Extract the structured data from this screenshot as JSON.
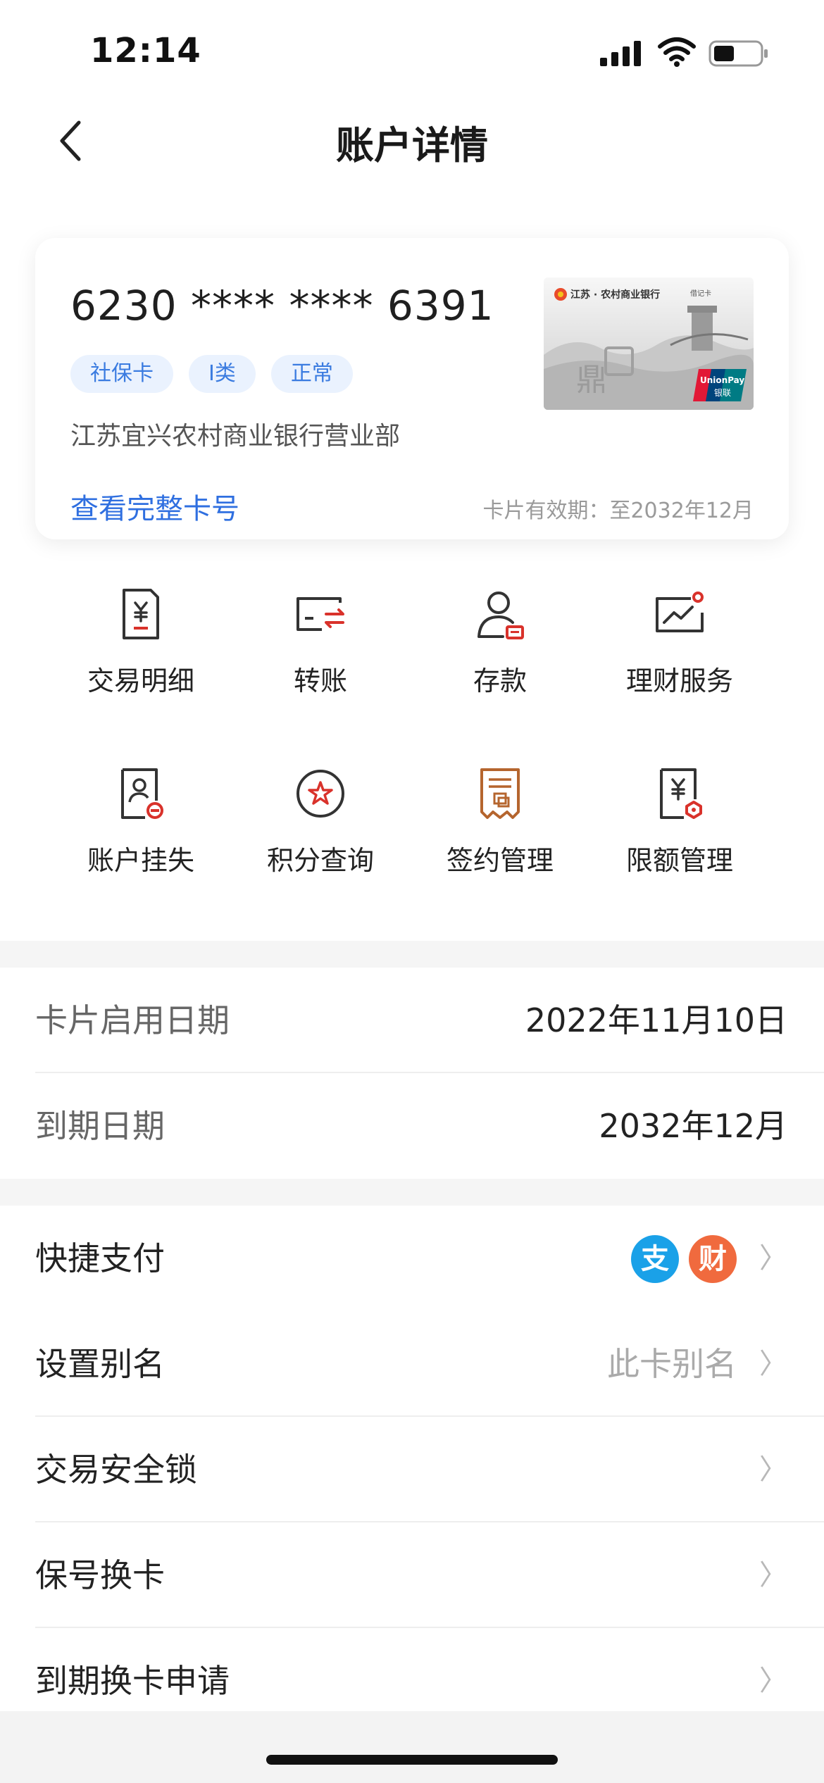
{
  "status_bar": {
    "time": "12:14"
  },
  "nav": {
    "title": "账户详情"
  },
  "card": {
    "number_masked": "6230 **** **** 6391",
    "tags": [
      "社保卡",
      "I类",
      "正常"
    ],
    "branch": "江苏宜兴农村商业银行营业部",
    "view_full_label": "查看完整卡号",
    "expiry_note": "卡片有效期：至2032年12月",
    "image": {
      "bank_line": "江苏 · 农村商业银行",
      "card_kind": "借记卡",
      "brand_logo": "UnionPay"
    }
  },
  "services": [
    {
      "label": "交易明细",
      "icon": "transaction-detail-icon"
    },
    {
      "label": "转账",
      "icon": "transfer-icon"
    },
    {
      "label": "存款",
      "icon": "deposit-icon"
    },
    {
      "label": "理财服务",
      "icon": "wealth-management-icon"
    },
    {
      "label": "账户挂失",
      "icon": "report-loss-icon"
    },
    {
      "label": "积分查询",
      "icon": "points-query-icon"
    },
    {
      "label": "签约管理",
      "icon": "contract-management-icon"
    },
    {
      "label": "限额管理",
      "icon": "limit-management-icon"
    }
  ],
  "info": {
    "activation_label": "卡片启用日期",
    "activation_value": "2022年11月10日",
    "expiry_label": "到期日期",
    "expiry_value": "2032年12月"
  },
  "settings": {
    "quick_pay_label": "快捷支付",
    "quick_pay_icons": [
      {
        "glyph": "支",
        "icon": "alipay-icon",
        "color": "#1aa1e8"
      },
      {
        "glyph": "财",
        "icon": "caifutong-icon",
        "color": "#f06a3e"
      }
    ],
    "alias_label": "设置别名",
    "alias_placeholder": "此卡别名",
    "security_lock_label": "交易安全锁",
    "keep_number_label": "保号换卡",
    "renewal_label": "到期换卡申请",
    "chevron": "〉"
  },
  "colors": {
    "accent_blue": "#2f6fe0",
    "icon_red": "#d9322b",
    "icon_stroke": "#333333",
    "tag_bg": "#eaf2fe"
  }
}
